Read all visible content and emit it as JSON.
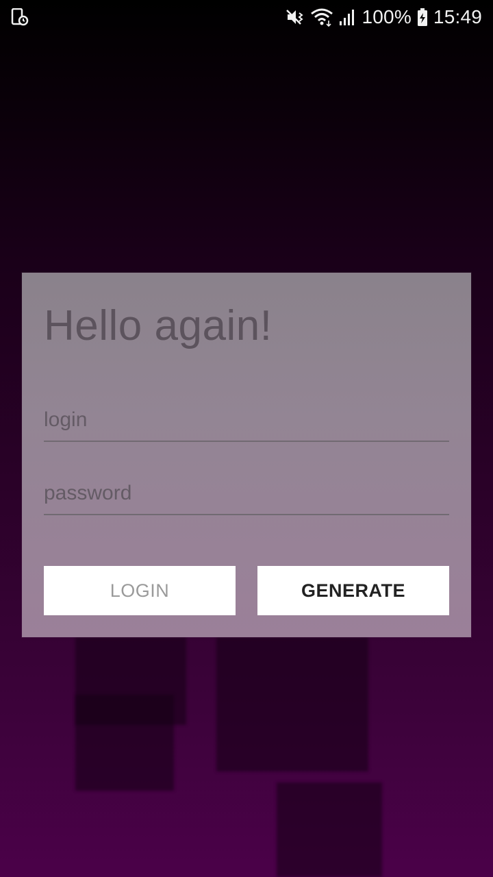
{
  "status_bar": {
    "battery_percent": "100%",
    "time": "15:49",
    "icons": [
      "screen-record-icon",
      "mute-vibrate-icon",
      "wifi-icon",
      "signal-icon",
      "battery-charging-icon"
    ]
  },
  "card": {
    "title": "Hello again!",
    "login_placeholder": "login",
    "password_placeholder": "password",
    "login_button": "LOGIN",
    "generate_button": "GENERATE"
  },
  "colors": {
    "background_top": "#000000",
    "background_bottom": "#4b0149",
    "card": "#938594",
    "button": "#ffffff"
  }
}
